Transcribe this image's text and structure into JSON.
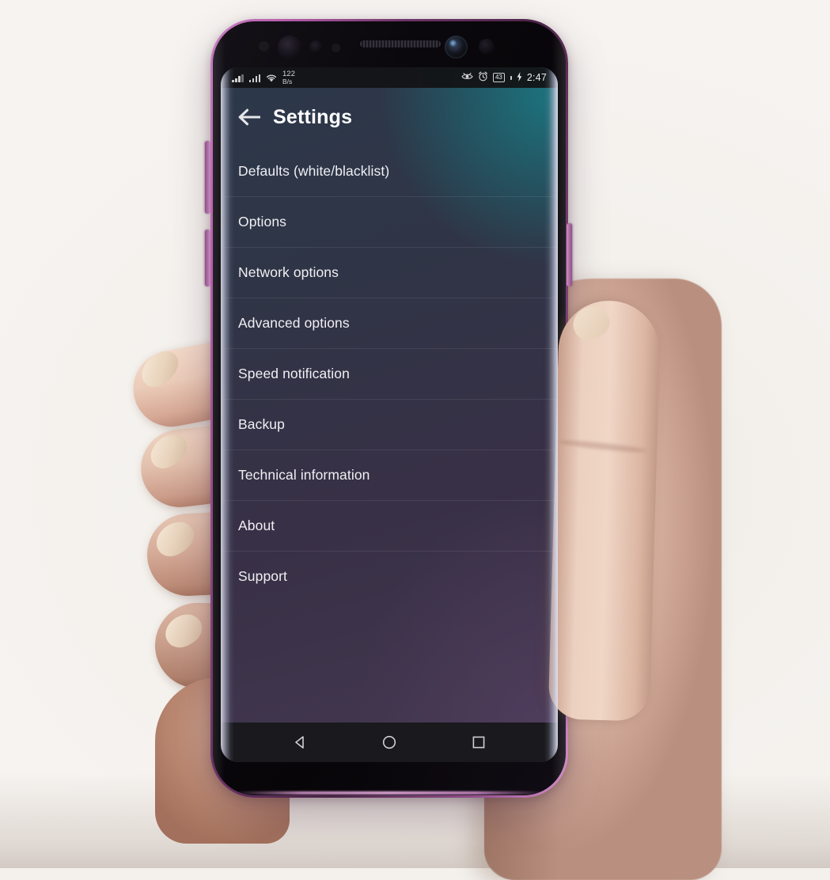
{
  "scene": {
    "background_color": "#f4f1ed",
    "device_frame_color": "#b95fae",
    "description_name": "phone-in-hand-mockup"
  },
  "status_bar": {
    "signal_icon_1": "signal-bars-icon",
    "signal_icon_2": "signal-bars-icon",
    "wifi_icon": "wifi-icon",
    "data_speed_value": "122",
    "data_speed_unit": "B/s",
    "eye_comfort_icon": "eye-icon",
    "alarm_icon": "alarm-clock-icon",
    "battery_level": "43",
    "charging_icon": "charging-bolt-icon",
    "time": "2:47"
  },
  "app": {
    "back_icon": "back-arrow-icon",
    "title": "Settings",
    "text_color": "#ffffff",
    "screen_gradient_top": "#1d5962",
    "screen_gradient_bottom": "#463b53"
  },
  "settings_list": {
    "items": [
      {
        "label": "Defaults (white/blacklist)"
      },
      {
        "label": "Options"
      },
      {
        "label": "Network options"
      },
      {
        "label": "Advanced options"
      },
      {
        "label": "Speed notification"
      },
      {
        "label": "Backup"
      },
      {
        "label": "Technical information"
      },
      {
        "label": "About"
      },
      {
        "label": "Support"
      }
    ]
  },
  "nav_bar": {
    "back": "nav-back-icon",
    "home": "nav-home-icon",
    "recents": "nav-recents-icon"
  },
  "hardware": {
    "front_camera": "front-camera",
    "earpiece": "earpiece-speaker",
    "volume_up": "volume-up-button",
    "volume_down": "volume-down-button",
    "power": "power-button"
  }
}
